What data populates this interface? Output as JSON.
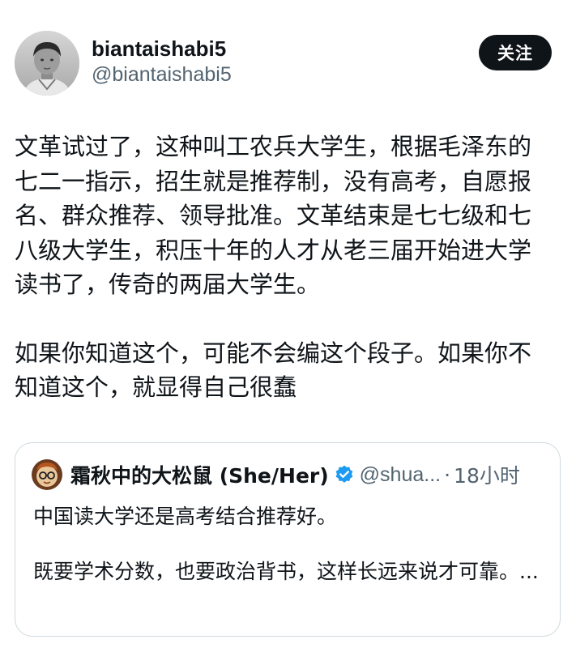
{
  "author": {
    "display_name": "biantaishabi5",
    "handle": "@biantaishabi5",
    "avatar_icon": "user-avatar-photo"
  },
  "follow_label": "关注",
  "post": {
    "paragraphs": [
      "文革试过了，这种叫工农兵大学生，根据毛泽东的七二一指示，招生就是推荐制，没有高考，自愿报名、群众推荐、领导批准。文革结束是七七级和七八级大学生，积压十年的人才从老三届开始进大学读书了，传奇的两届大学生。",
      "如果你知道这个，可能不会编这个段子。如果你不知道这个，就显得自己很蠢"
    ]
  },
  "quoted_post": {
    "display_name": "霜秋中的大松鼠 (She/Her)",
    "handle": "@shua...",
    "separator": "·",
    "time": "18小时",
    "verified_icon": "verified-badge-icon",
    "verified_color": "#1d9bf0",
    "paragraphs": [
      "中国读大学还是高考结合推荐好。",
      "既要学术分数，也要政治背书，这样长远来说才可靠。..."
    ]
  },
  "colors": {
    "text_primary": "#0f1419",
    "text_secondary": "#536471",
    "border": "#cfd9de",
    "follow_bg": "#0f1419"
  }
}
